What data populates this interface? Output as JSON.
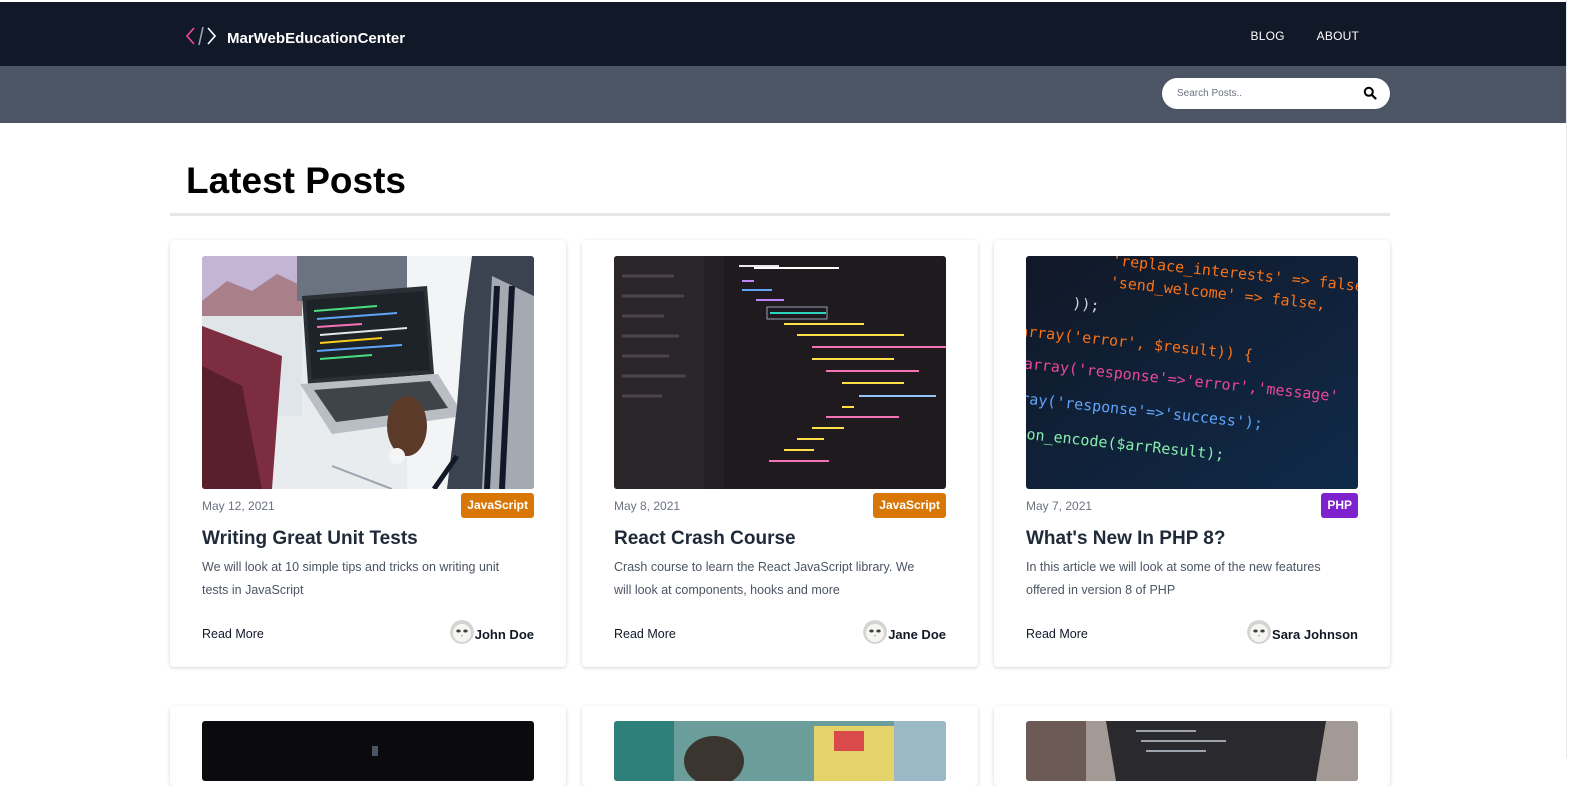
{
  "site": {
    "name": "MarWebEducationCenter",
    "logo_icon": "code-brackets-icon"
  },
  "nav": {
    "blog": "BLOG",
    "about": "ABOUT"
  },
  "search": {
    "placeholder": "Search Posts..",
    "icon": "search-icon"
  },
  "main": {
    "heading": "Latest Posts"
  },
  "colors": {
    "topbar": "#111827",
    "subbar": "#4b5563",
    "tag_javascript": "#d97706",
    "tag_php": "#7e22ce"
  },
  "posts": [
    {
      "date": "May 12, 2021",
      "tag": "JavaScript",
      "title": "Writing Great Unit Tests",
      "excerpt": "We will look at 10 simple tips and tricks on writing unit tests in JavaScript",
      "read_more": "Read More",
      "author": "John Doe"
    },
    {
      "date": "May 8, 2021",
      "tag": "JavaScript",
      "title": "React Crash Course",
      "excerpt": "Crash course to learn the React JavaScript library. We will look at components, hooks and more",
      "read_more": "Read More",
      "author": "Jane Doe"
    },
    {
      "date": "May 7, 2021",
      "tag": "PHP",
      "title": "What's New In PHP 8?",
      "excerpt": "In this article we will look at some of the new features offered in version 8 of PHP",
      "read_more": "Read More",
      "author": "Sara Johnson"
    }
  ],
  "code_image": {
    "lines": [
      "'replace_interests' => false,",
      "'send_welcome'      => false,",
      "));",
      "array('error', $result)) {",
      "= array('response'=>'error','message'",
      "array('response'=>'success');",
      "json_encode($arrResult);"
    ]
  }
}
